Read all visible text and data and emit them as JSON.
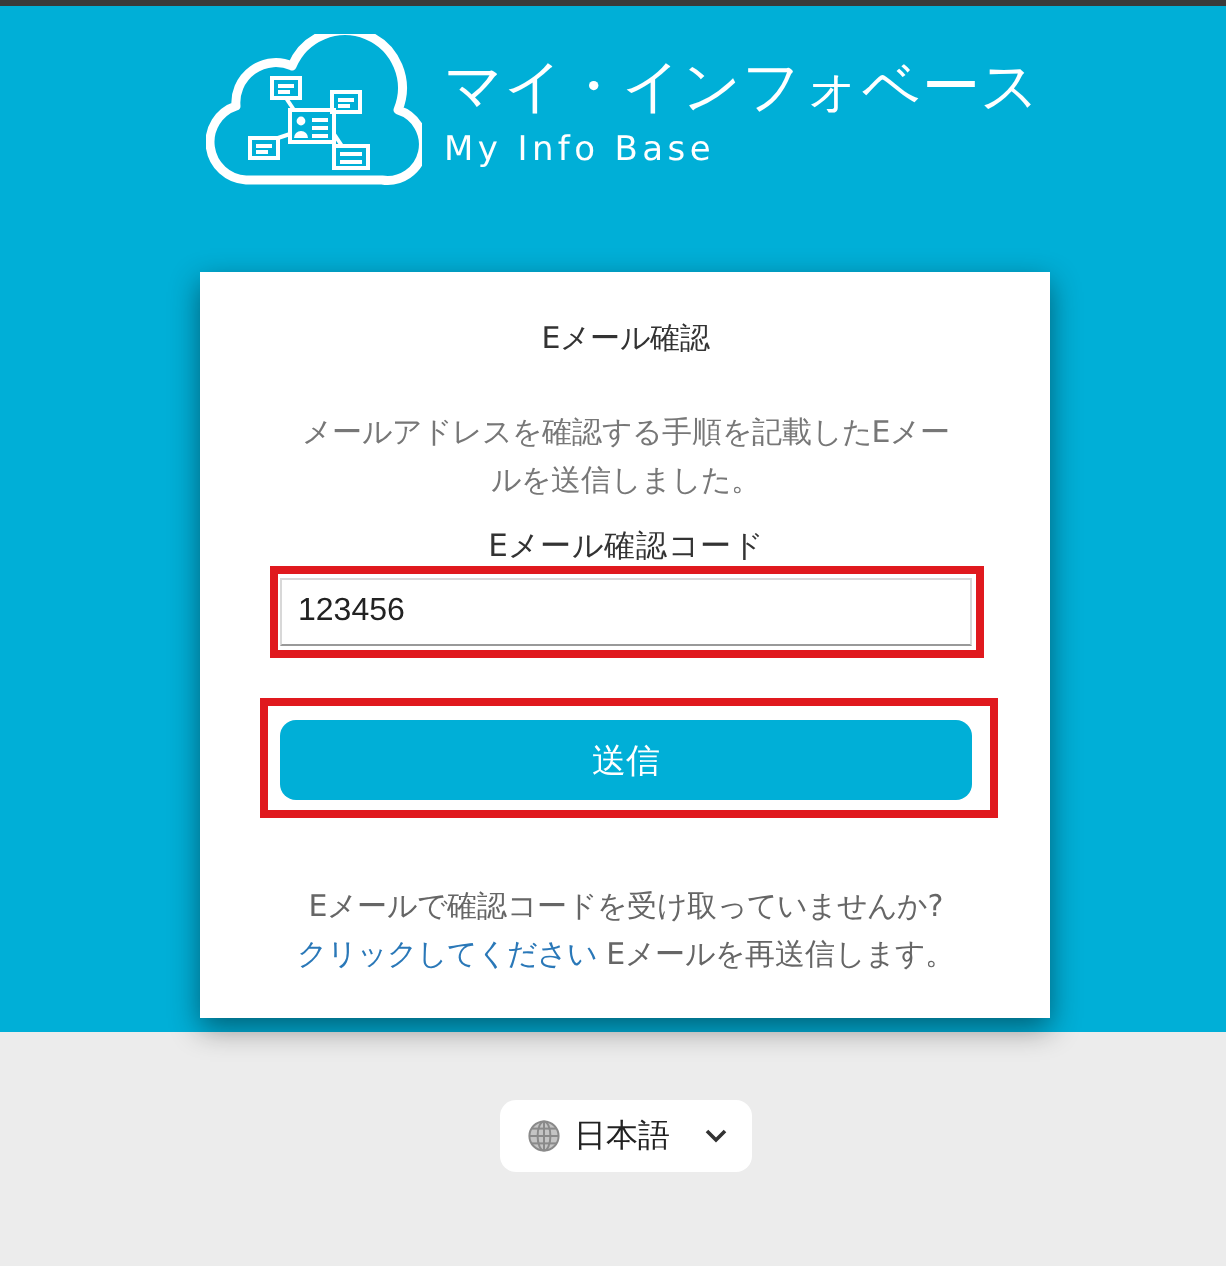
{
  "logo": {
    "title": "マイ・インフォベース",
    "subtitle": "My Info Base"
  },
  "card": {
    "title": "Eメール確認",
    "description": "メールアドレスを確認する手順を記載したEメールを送信しました。",
    "code_field": {
      "label": "Eメール確認コード",
      "value": "123456",
      "highlighted": true
    },
    "submit_button": {
      "label": "送信",
      "highlighted": true
    },
    "resend_question": "Eメールで確認コードを受け取っていませんか?",
    "resend_link": "クリックしてください",
    "resend_text": "Eメールを再送信します。"
  },
  "language_selector": {
    "label": "日本語"
  }
}
